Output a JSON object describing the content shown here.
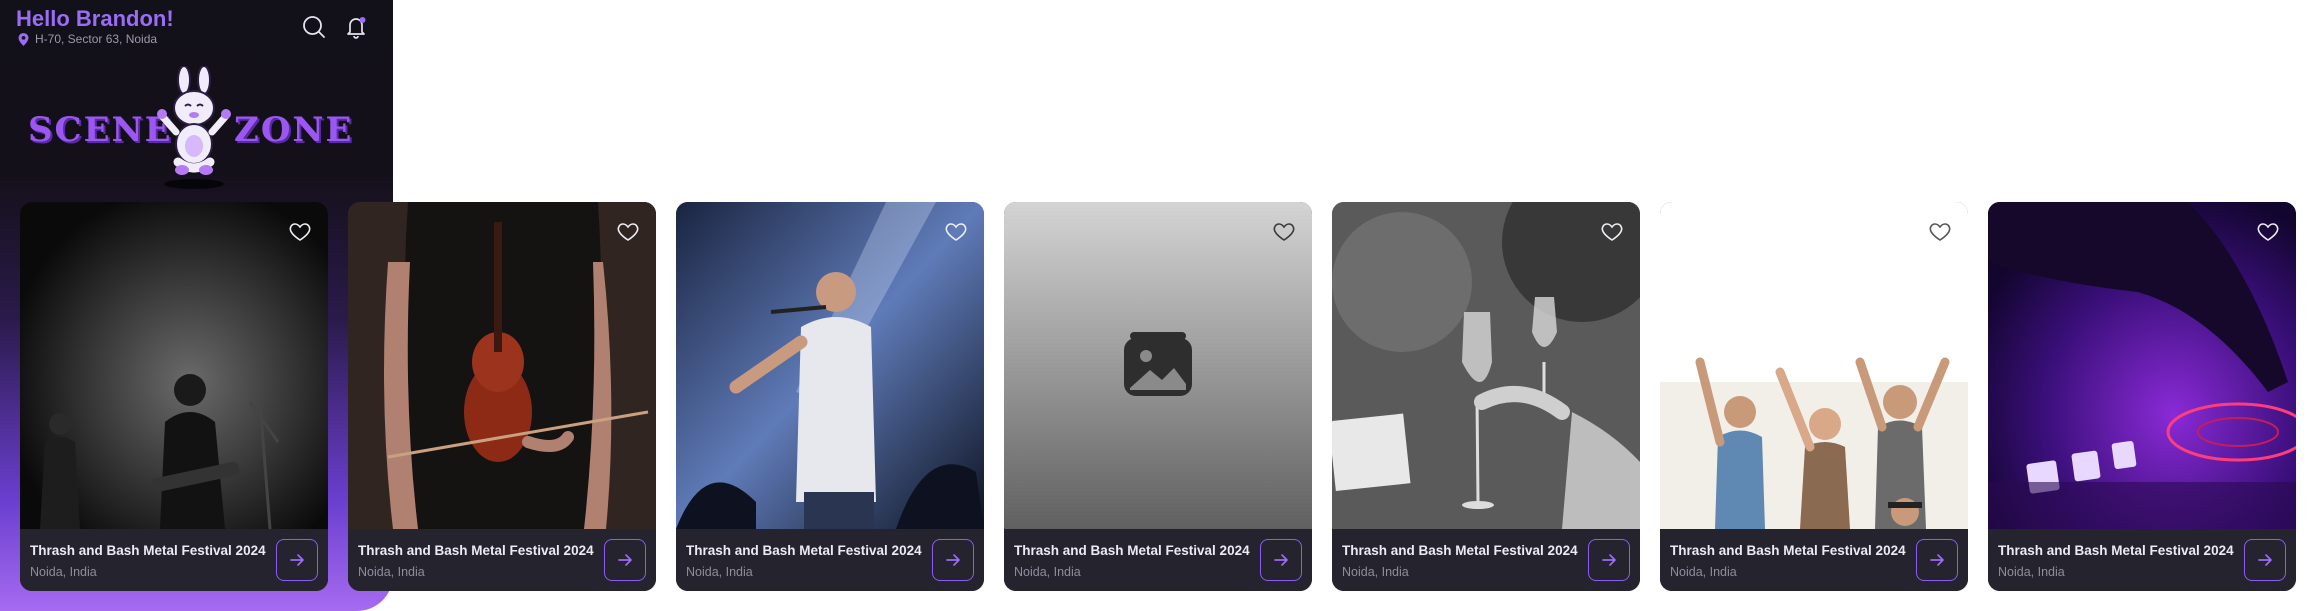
{
  "header": {
    "greeting": "Hello Brandon!",
    "location": "H-70, Sector 63, Noida",
    "icons": [
      "search-icon",
      "bell-icon",
      "location-pin-icon"
    ]
  },
  "logo": {
    "word_left": "SCENE",
    "word_right": "ZONE"
  },
  "colors": {
    "accent": "#9b6cf5",
    "panel_dark": "#121019",
    "panel_purple": "#a66bf0",
    "card_info_bg": "#25232e"
  },
  "events": [
    {
      "title": "Thrash and Bash Metal Festival 2024",
      "location": "Noida, India",
      "image": "band-stage-bw"
    },
    {
      "title": "Thrash and Bash Metal Festival 2024",
      "location": "Noida, India",
      "image": "violinist"
    },
    {
      "title": "Thrash and Bash Metal Festival 2024",
      "location": "Noida, India",
      "image": "singer-spotlight"
    },
    {
      "title": "Thrash and Bash Metal Festival 2024",
      "location": "Noida, India",
      "image": "image-placeholder-icon"
    },
    {
      "title": "Thrash and Bash Metal Festival 2024",
      "location": "Noida, India",
      "image": "wine-glasses-bw"
    },
    {
      "title": "Thrash and Bash Metal Festival 2024",
      "location": "Noida, India",
      "image": "crowd-cheering"
    },
    {
      "title": "Thrash and Bash Metal Festival 2024",
      "location": "Noida, India",
      "image": "dj-turntable-purple"
    }
  ]
}
